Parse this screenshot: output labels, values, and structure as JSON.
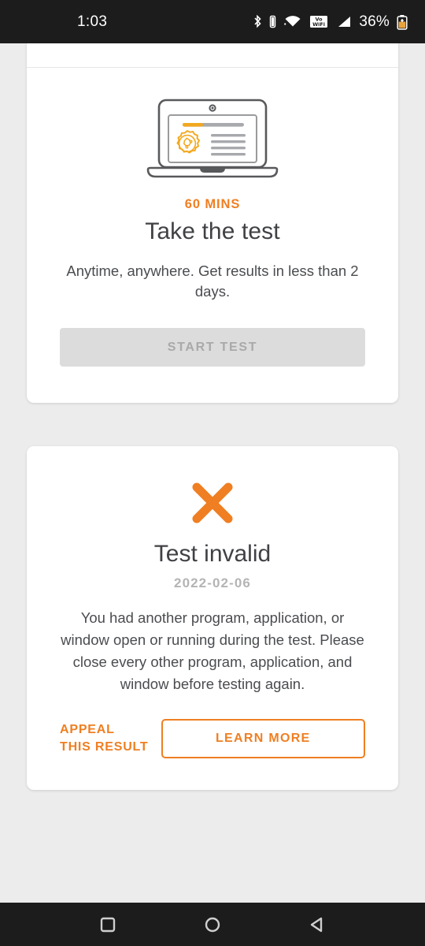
{
  "status_bar": {
    "time": "1:03",
    "battery_percent": "36%",
    "icons": [
      "bluetooth-icon",
      "bluetooth-battery-icon",
      "wifi-icon",
      "volte-wifi-icon",
      "cellular-signal-icon",
      "battery-icon"
    ]
  },
  "test_card": {
    "illustration": "laptop-test-illustration",
    "eyebrow": "60 MINS",
    "title": "Take the test",
    "description": "Anytime, anywhere. Get results in less than 2 days.",
    "start_button": {
      "label": "START TEST",
      "disabled": true
    }
  },
  "result_card": {
    "status_icon": "x-mark-icon",
    "title": "Test invalid",
    "date": "2022-02-06",
    "description": "You had another program, application, or window open or running during the test. Please close every other program, application, and window before testing again.",
    "appeal_link": "APPEAL\nTHIS RESULT",
    "learn_more_button": "LEARN MORE"
  },
  "nav_bar": {
    "recents": "recents-square-icon",
    "home": "home-circle-icon",
    "back": "back-triangle-icon"
  },
  "colors": {
    "accent_orange": "#ef7f22",
    "heading_gray": "#3f4144",
    "body_gray": "#4a4c4f",
    "muted_gray": "#b4b4b4",
    "disabled_bg": "#dcdcdc",
    "page_bg": "#ececec",
    "bar_black": "#1c1c1c"
  }
}
